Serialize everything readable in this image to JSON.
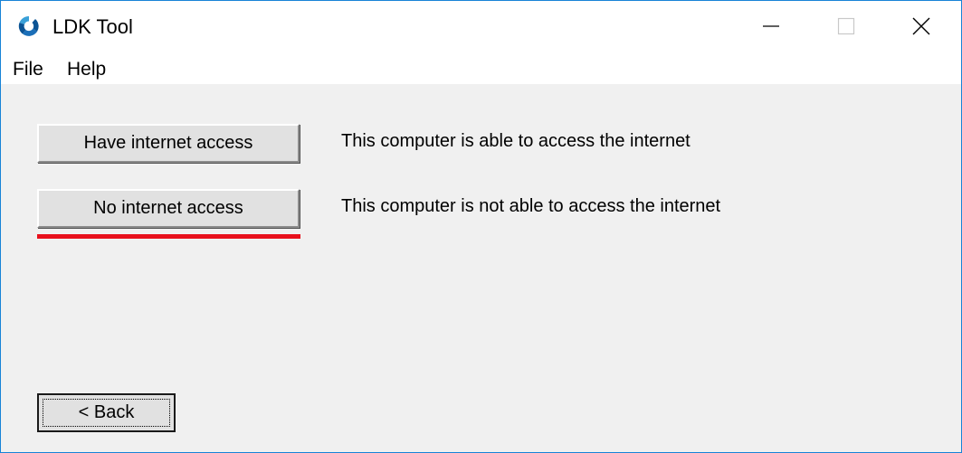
{
  "window": {
    "title": "LDK Tool",
    "controls": {
      "minimize_icon": "minimize-icon",
      "maximize_icon": "maximize-icon",
      "close_icon": "close-icon"
    }
  },
  "menu": {
    "items": [
      {
        "label": "File"
      },
      {
        "label": "Help"
      }
    ]
  },
  "options": [
    {
      "button_label": "Have internet access",
      "description": "This computer is able to access the internet"
    },
    {
      "button_label": "No internet access",
      "description": "This computer is not able to access the internet"
    }
  ],
  "back_button": {
    "label": "< Back"
  },
  "colors": {
    "highlight_underline": "#e8101c",
    "window_border": "#1883d7",
    "client_background": "#f0f0f0",
    "app_icon_primary": "#0b5394",
    "app_icon_secondary": "#3aa0d8"
  }
}
